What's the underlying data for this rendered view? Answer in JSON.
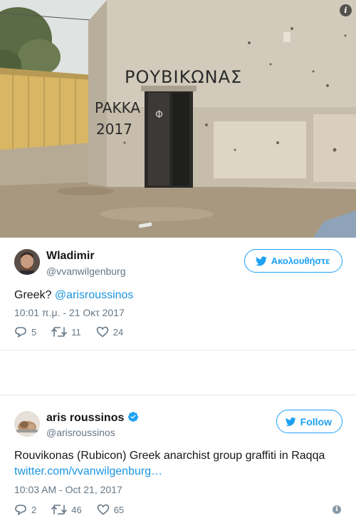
{
  "photo": {
    "graffiti_top": "ΡΟΥΒΙΚΩΝΑΣ",
    "graffiti_left_1": "PAKKA",
    "graffiti_left_2": "2017",
    "info_icon": "info-icon"
  },
  "tweets": [
    {
      "name": "Wladimir",
      "handle": "@vvanwilgenburg",
      "follow_label": "Ακολουθήστε",
      "text": "Greek? ",
      "mention": "@arisroussinos",
      "time": "10:01 π.μ. - 21 Οκτ 2017",
      "replies": "5",
      "retweets": "11",
      "likes": "24"
    },
    {
      "name": "aris roussinos",
      "handle": "@arisroussinos",
      "follow_label": "Follow",
      "text": "Rouvikonas (Rubicon) Greek anarchist group graffiti in Raqqa",
      "link": "twitter.com/vvanwilgenburg…",
      "time": "10:03 AM - Oct 21, 2017",
      "replies": "2",
      "retweets": "46",
      "likes": "65"
    }
  ],
  "colors": {
    "accent": "#1da1f2",
    "link": "#1b95e0",
    "muted": "#657786",
    "divider": "#e1e8ed"
  }
}
